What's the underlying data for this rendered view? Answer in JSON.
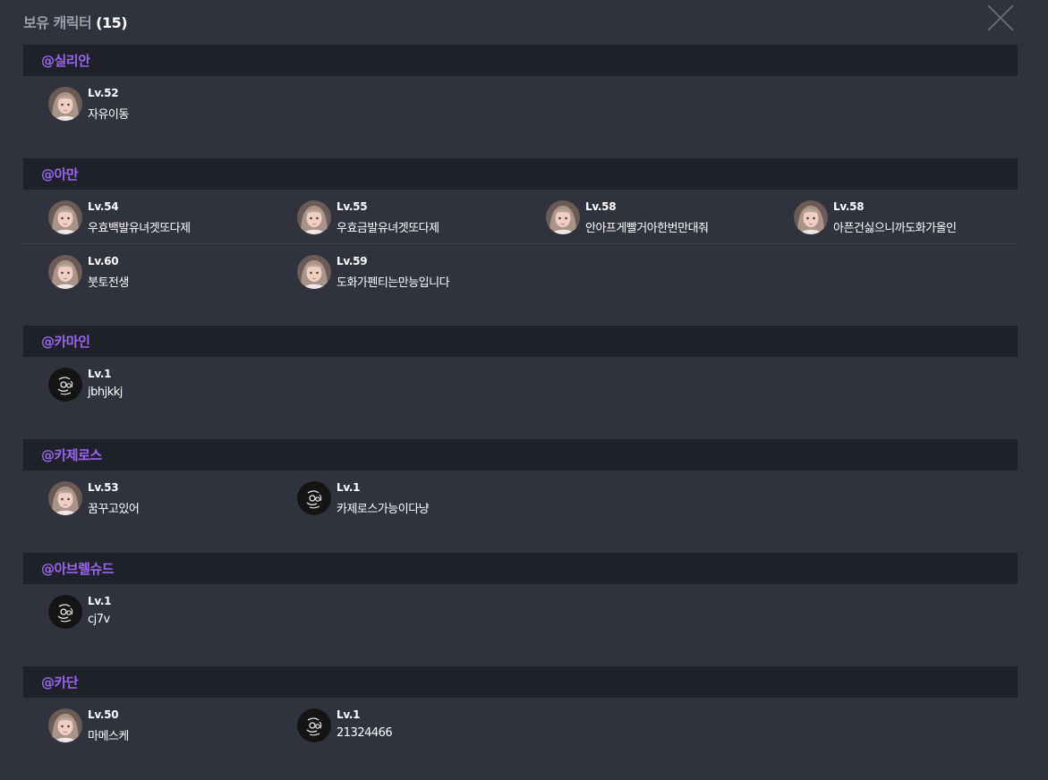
{
  "modal": {
    "title": "보유 캐릭터",
    "count": "(15)",
    "close_icon": "close-icon"
  },
  "colors": {
    "background": "#30333d",
    "header_background": "#1f212a",
    "server_name": "#9b65ee",
    "title": "#9aa0ad"
  },
  "servers": [
    {
      "name": "@실리안",
      "rows": [
        [
          {
            "level": "Lv.52",
            "name": "자유이동",
            "avatar": "female-character-portrait"
          }
        ]
      ]
    },
    {
      "name": "@아만",
      "rows": [
        [
          {
            "level": "Lv.54",
            "name": "우효백발유녀겟또다제",
            "avatar": "female-character-portrait"
          },
          {
            "level": "Lv.55",
            "name": "우효금발유녀겟또다제",
            "avatar": "female-character-portrait"
          },
          {
            "level": "Lv.58",
            "name": "안아프게빨거아한번만대줘",
            "avatar": "female-character-portrait"
          },
          {
            "level": "Lv.58",
            "name": "아픈건싫으니까도화가올인",
            "avatar": "female-character-portrait"
          }
        ],
        [
          {
            "level": "Lv.60",
            "name": "붓토전생",
            "avatar": "female-character-portrait"
          },
          {
            "level": "Lv.59",
            "name": "도화가펜티는만능입니다",
            "avatar": "female-character-portrait"
          }
        ]
      ]
    },
    {
      "name": "@카마인",
      "rows": [
        [
          {
            "level": "Lv.1",
            "name": "jbhjkkj",
            "avatar": "default-emblem"
          }
        ]
      ]
    },
    {
      "name": "@카제로스",
      "rows": [
        [
          {
            "level": "Lv.53",
            "name": "꿈꾸고있어",
            "avatar": "female-character-portrait"
          },
          {
            "level": "Lv.1",
            "name": "카제로스가능이다냥",
            "avatar": "default-emblem"
          }
        ]
      ]
    },
    {
      "name": "@아브렐슈드",
      "rows": [
        [
          {
            "level": "Lv.1",
            "name": "cj7v",
            "avatar": "default-emblem"
          }
        ]
      ]
    },
    {
      "name": "@카단",
      "rows": [
        [
          {
            "level": "Lv.50",
            "name": "마메스케",
            "avatar": "female-character-portrait"
          },
          {
            "level": "Lv.1",
            "name": "21324466",
            "avatar": "default-emblem"
          }
        ]
      ]
    }
  ]
}
